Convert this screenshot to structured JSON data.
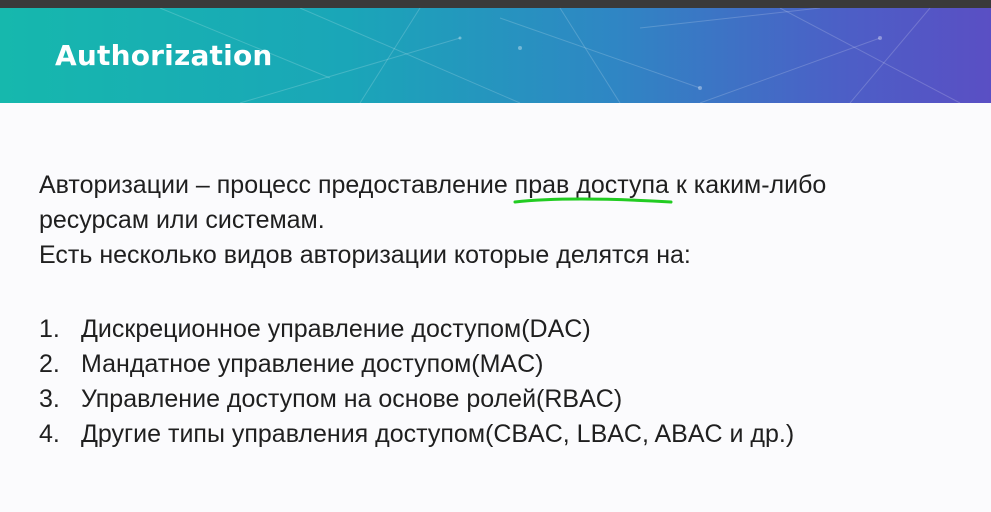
{
  "slide": {
    "title": "Authorization",
    "intro_line_1": "Авторизации – процесс предоставление прав доступа к каким-либо",
    "intro_line_2": "ресурсам или системам.",
    "intro_line_3": "Есть несколько видов авторизации которые делятся на:",
    "list": [
      {
        "number": "1.",
        "text": "Дискреционное управление доступом(DAC)"
      },
      {
        "number": "2.",
        "text": "Мандатное управление доступом(MAC)"
      },
      {
        "number": "3.",
        "text": "Управление доступом на основе ролей(RBAC)"
      },
      {
        "number": "4.",
        "text": "Другие типы управления доступом(CBAC, LBAC, ABAC и др.)"
      }
    ]
  },
  "colors": {
    "banner_start": "#16b8ad",
    "banner_end": "#5a4fc4",
    "underline": "#22cc22",
    "text": "#1f1f1f"
  }
}
